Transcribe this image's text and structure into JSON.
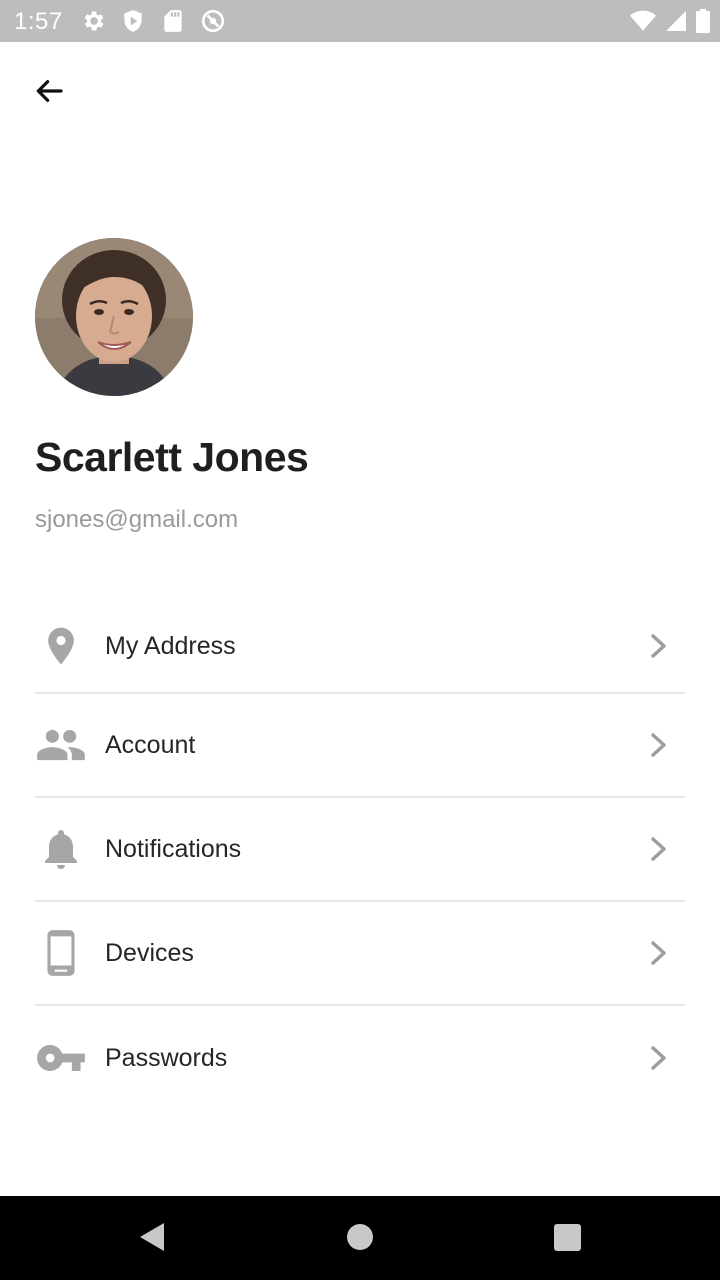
{
  "status_bar": {
    "time": "1:57",
    "icons_left": [
      "gear-icon",
      "shield-icon",
      "sd-card-icon",
      "no-sync-icon"
    ],
    "icons_right": [
      "wifi-icon",
      "signal-icon",
      "battery-icon"
    ]
  },
  "header": {
    "back_icon": "arrow-left-icon"
  },
  "profile": {
    "name": "Scarlett Jones",
    "email": "sjones@gmail.com"
  },
  "menu": {
    "items": [
      {
        "label": "My Address",
        "icon": "location-pin-icon"
      },
      {
        "label": "Account",
        "icon": "people-icon"
      },
      {
        "label": "Notifications",
        "icon": "bell-icon"
      },
      {
        "label": "Devices",
        "icon": "phone-icon"
      },
      {
        "label": "Passwords",
        "icon": "key-icon"
      }
    ]
  },
  "colors": {
    "status_bar": "#bdbdbd",
    "icon_gray": "#a6a6a6",
    "divider": "#e6e6e6",
    "email_gray": "#9a9a9a"
  }
}
